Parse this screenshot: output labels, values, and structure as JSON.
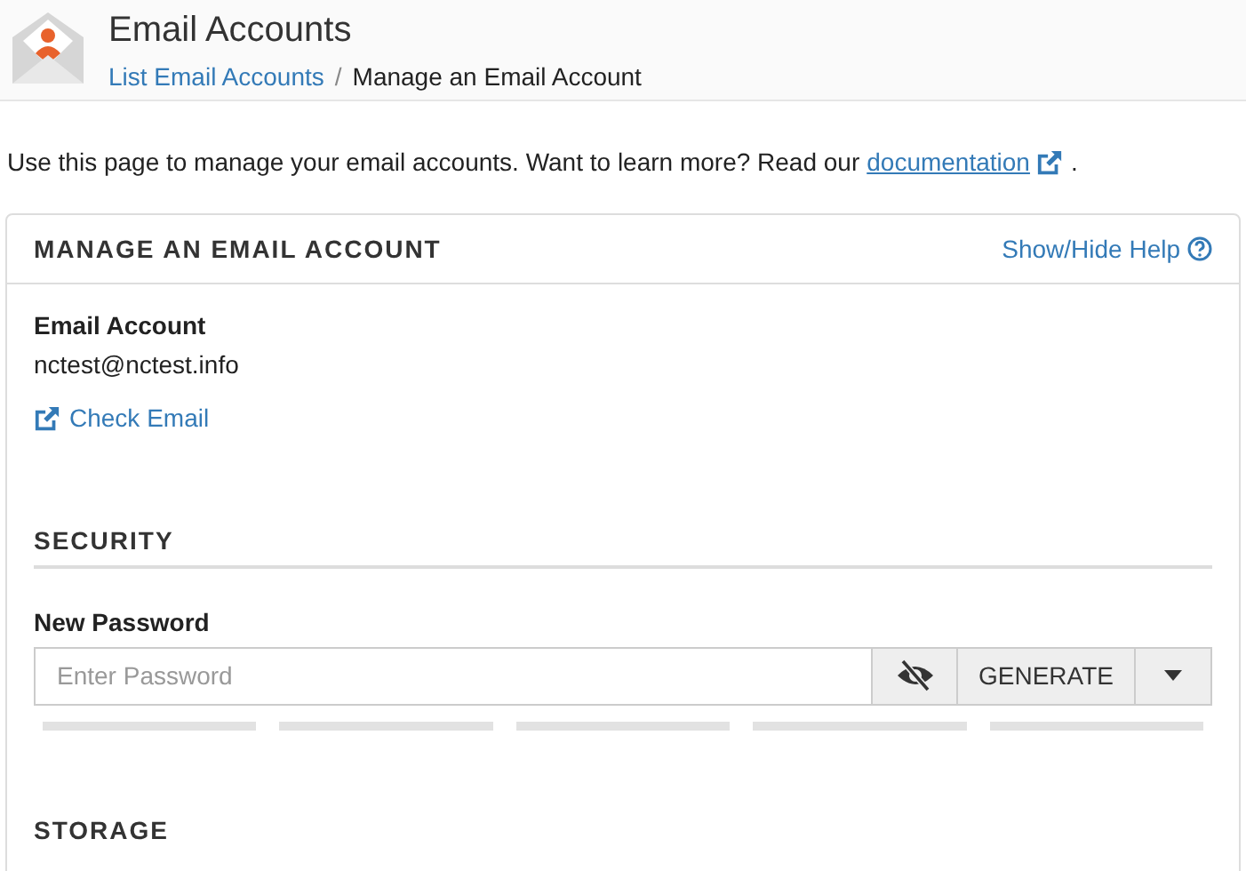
{
  "header": {
    "title": "Email Accounts",
    "breadcrumb": [
      {
        "label": "List Email Accounts",
        "kind": "link"
      },
      {
        "label": "/",
        "kind": "separator"
      },
      {
        "label": "Manage an Email Account",
        "kind": "current"
      }
    ]
  },
  "intro": {
    "text": "Use this page to manage your email accounts. Want to learn more? Read our",
    "link": "documentation",
    "end": "."
  },
  "card": {
    "title": "MANAGE AN EMAIL ACCOUNT",
    "help_link": "Show/Hide Help",
    "account": {
      "label": "Email Account",
      "value": "nctest@nctest.info",
      "check_link": "Check Email"
    },
    "security": {
      "heading": "SECURITY",
      "password_label": "New Password",
      "placeholder": "Enter Password",
      "generate": "GENERATE",
      "strength": {
        "level": 0
      }
    },
    "next_heading": "STORAGE"
  }
}
